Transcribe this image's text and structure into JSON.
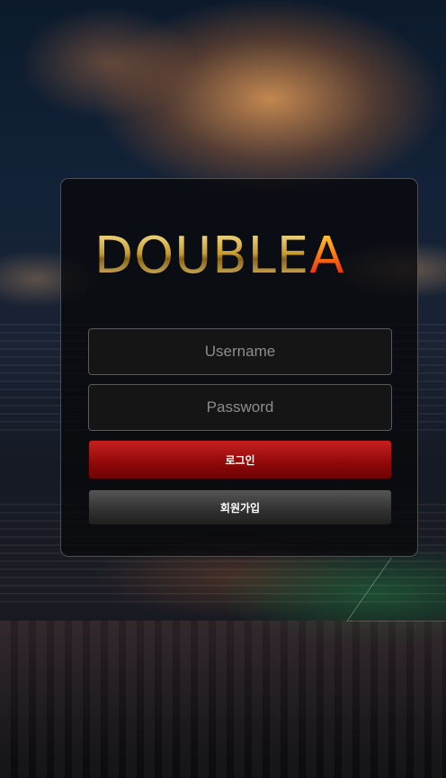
{
  "logo": {
    "text_main": "DOUBLE",
    "text_accent": "A"
  },
  "login_form": {
    "username_placeholder": "Username",
    "password_placeholder": "Password",
    "login_label": "로그인",
    "signup_label": "회원가입"
  },
  "colors": {
    "login_button": "#a10f0f",
    "signup_button": "#3a3a3a",
    "logo_gold": "#d4a843",
    "logo_accent": "#ff5a10"
  }
}
